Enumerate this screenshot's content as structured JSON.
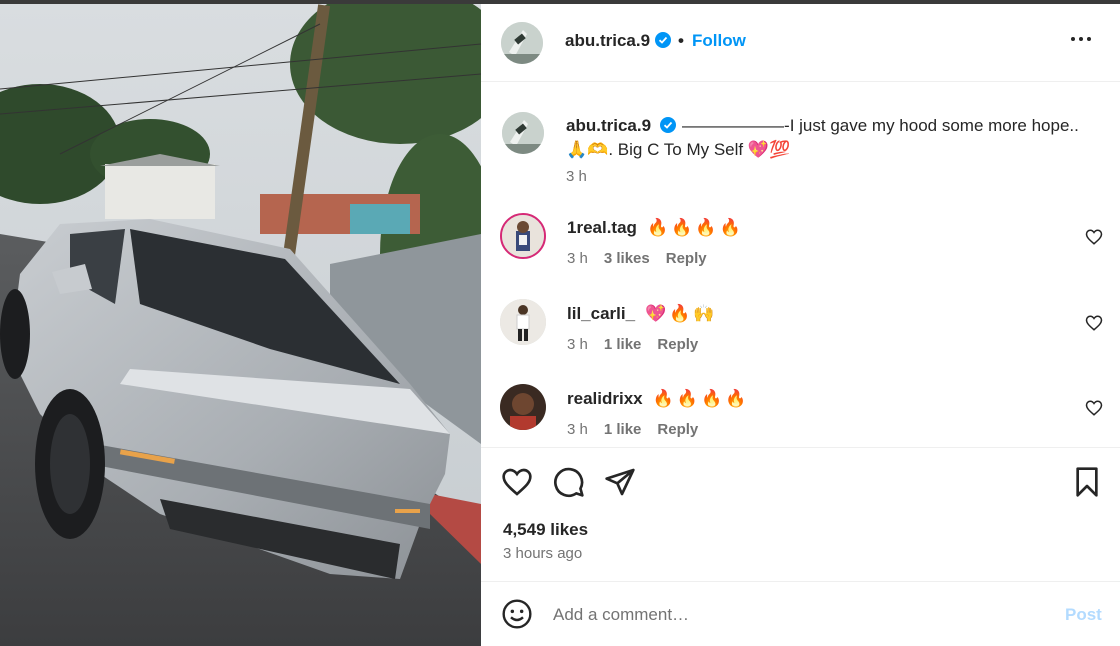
{
  "post": {
    "author": "abu.trica.9",
    "verified": true,
    "follow_label": "Follow",
    "separator": "•",
    "more_icon": "more-horizontal-icon",
    "caption": {
      "username": "abu.trica.9",
      "text": "——————-I just gave my hood some more hope.. 🙏🫶. Big C To My Self 💖💯",
      "time": "3 h"
    },
    "comments": [
      {
        "username": "1real.tag",
        "text": "🔥🔥🔥🔥",
        "time": "3 h",
        "likes": "3 likes",
        "reply_label": "Reply"
      },
      {
        "username": "lil_carli_",
        "text": "💖🔥🙌",
        "time": "3 h",
        "likes": "1 like",
        "reply_label": "Reply"
      },
      {
        "username": "realidrixx",
        "text": "🔥🔥🔥🔥",
        "time": "3 h",
        "likes": "1 like",
        "reply_label": "Reply"
      }
    ],
    "likes": "4,549 likes",
    "posted": "3 hours ago",
    "add_comment": {
      "placeholder": "Add a comment…",
      "value": "",
      "post_label": "Post"
    },
    "icons": [
      "heart-icon",
      "comment-icon",
      "share-icon",
      "bookmark-icon",
      "emoji-icon"
    ],
    "colors": {
      "accent": "#0095f6",
      "post_disabled": "#b3dbff",
      "verified": "#0095f6",
      "secondary_text": "#737373"
    }
  }
}
